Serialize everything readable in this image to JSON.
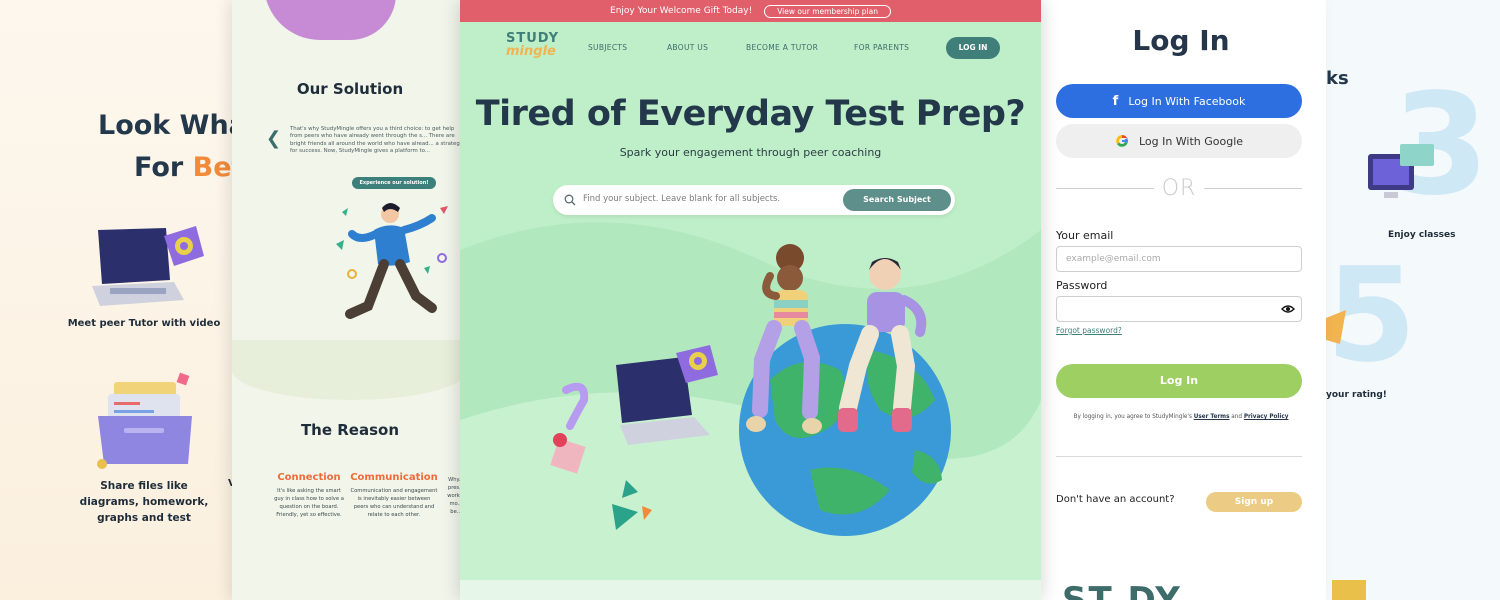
{
  "left_panel": {
    "heading_line1": "Look Wha",
    "heading_line2_part1": "For ",
    "heading_line2_part2": "Bet",
    "caption1": "Meet peer Tutor with video",
    "caption2": "Share files like diagrams, homework, graphs and test",
    "cut_caption": "V"
  },
  "solution_panel": {
    "title": "Our Solution",
    "paragraph": "That's why StudyMingle offers you a third choice: to get help from peers who have already went through the s... There are bright friends all around the world who have alread... a strategy for success. Now, StudyMingle gives a platform to...",
    "cta": "Experience our solution!",
    "reason_title": "The Reason",
    "columns": [
      {
        "title": "Connection",
        "text": "It's like asking the smart guy in class how to solve a question on the board. Friendly, yet so effective."
      },
      {
        "title": "Communication",
        "text": "Communication and engagement is inevitably easier between peers who can understand and relate to each other."
      },
      {
        "title": "",
        "text": "Why... pres... work... mo... be..."
      }
    ]
  },
  "main": {
    "banner_text": "Enjoy Your Welcome Gift Today!",
    "banner_button": "View our membership plan",
    "logo_line1": "STUDY",
    "logo_line2": "mingle",
    "nav": [
      "SUBJECTS",
      "ABOUT US",
      "BECOME A TUTOR",
      "FOR PARENTS"
    ],
    "nav_login": "LOG IN",
    "hero_title": "Tired of Everyday Test Prep?",
    "hero_subtitle": "Spark your engagement through peer coaching",
    "search_placeholder": "Find your subject. Leave blank for all subjects.",
    "search_button": "Search Subject",
    "colors": {
      "bg": "#bfefc8",
      "accent": "#3f7e79",
      "banner": "#e05f6b"
    }
  },
  "login_panel": {
    "title": "Log In",
    "facebook": "Log In With Facebook",
    "google": "Log In With Google",
    "or": "OR",
    "email_label": "Your email",
    "email_placeholder": "example@email.com",
    "password_label": "Password",
    "forgot": "Forgot password?",
    "login_button": "Log In",
    "terms_prefix": "By logging in, you agree to StudyMingle's ",
    "terms_link": "User Terms",
    "terms_and": " and ",
    "privacy_link": "Privacy Policy",
    "no_account": "Don't have an account?",
    "signup": "Sign up",
    "footer_logo": "ST DY"
  },
  "right_panel": {
    "cut_title": "ks",
    "num_a": "3",
    "num_b": "5",
    "enjoy": "Enjoy classes",
    "rating": "your rating!"
  }
}
